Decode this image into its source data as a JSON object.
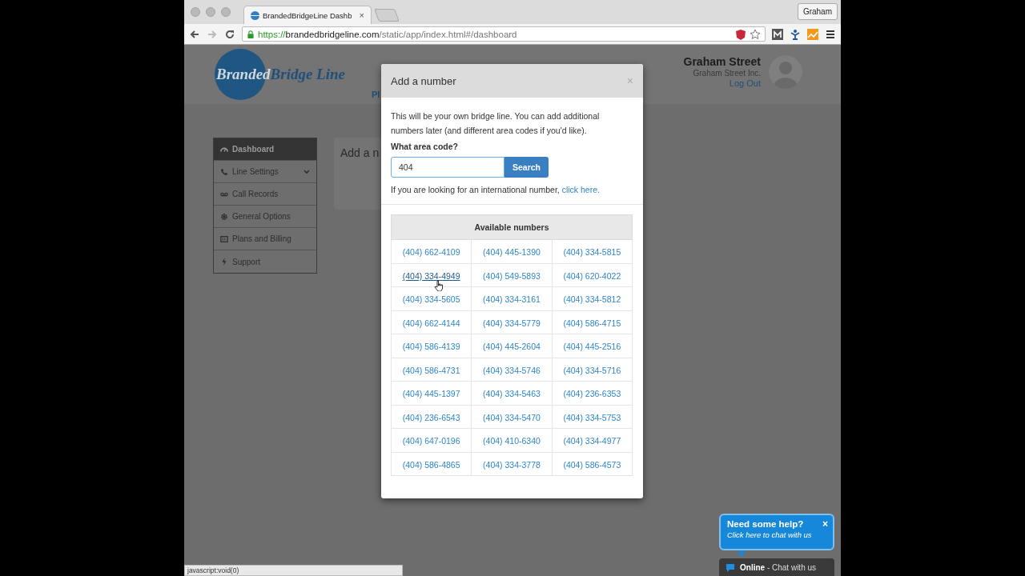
{
  "browser": {
    "tab_title": "BrandedBridgeLine Dashb",
    "tab_close": "×",
    "profile": "Graham",
    "url": {
      "scheme": "https://",
      "host": "brandedbridgeline.com",
      "path": "/static/app/index.html#/dashboard"
    },
    "status_text": "javascript:void(0)"
  },
  "header": {
    "logo": {
      "part1": "Branded",
      "part2": "Bridge Line"
    },
    "nav_partial": "Pl",
    "user": {
      "name": "Graham Street",
      "company": "Graham Street Inc.",
      "logout": "Log Out"
    }
  },
  "sidebar": {
    "items": [
      {
        "label": "Dashboard",
        "selected": true,
        "has_caret": false
      },
      {
        "label": "Line Settings",
        "selected": false,
        "has_caret": true
      },
      {
        "label": "Call Records",
        "selected": false,
        "has_caret": false
      },
      {
        "label": "General Options",
        "selected": false,
        "has_caret": false
      },
      {
        "label": "Plans and Billing",
        "selected": false,
        "has_caret": false
      },
      {
        "label": "Support",
        "selected": false,
        "has_caret": false
      }
    ]
  },
  "panel_title_partial": "Add a n",
  "modal": {
    "title": "Add a number",
    "close": "×",
    "intro": "This will be your own bridge line. You can add additional numbers later (and different area codes if you'd like).",
    "label": "What area code?",
    "input_value": "404",
    "search_button": "Search",
    "hint": "If you are looking for an international number,",
    "hint_link": "click here.",
    "table": {
      "header": "Available numbers",
      "rows": [
        [
          {
            "number": "(404) 662-4109",
            "hovered": false
          },
          {
            "number": "(404) 445-1390",
            "hovered": false
          },
          {
            "number": "(404) 334-5815",
            "hovered": false
          }
        ],
        [
          {
            "number": "(404) 334-4949",
            "hovered": true
          },
          {
            "number": "(404) 549-5893",
            "hovered": false
          },
          {
            "number": "(404) 620-4022",
            "hovered": false
          }
        ],
        [
          {
            "number": "(404) 334-5605",
            "hovered": false
          },
          {
            "number": "(404) 334-3161",
            "hovered": false
          },
          {
            "number": "(404) 334-5812",
            "hovered": false
          }
        ],
        [
          {
            "number": "(404) 662-4144",
            "hovered": false
          },
          {
            "number": "(404) 334-5779",
            "hovered": false
          },
          {
            "number": "(404) 586-4715",
            "hovered": false
          }
        ],
        [
          {
            "number": "(404) 586-4139",
            "hovered": false
          },
          {
            "number": "(404) 445-2604",
            "hovered": false
          },
          {
            "number": "(404) 445-2516",
            "hovered": false
          }
        ],
        [
          {
            "number": "(404) 586-4731",
            "hovered": false
          },
          {
            "number": "(404) 334-5746",
            "hovered": false
          },
          {
            "number": "(404) 334-5716",
            "hovered": false
          }
        ],
        [
          {
            "number": "(404) 445-1397",
            "hovered": false
          },
          {
            "number": "(404) 334-5463",
            "hovered": false
          },
          {
            "number": "(404) 236-6353",
            "hovered": false
          }
        ],
        [
          {
            "number": "(404) 236-6543",
            "hovered": false
          },
          {
            "number": "(404) 334-5470",
            "hovered": false
          },
          {
            "number": "(404) 334-5753",
            "hovered": false
          }
        ],
        [
          {
            "number": "(404) 647-0196",
            "hovered": false
          },
          {
            "number": "(404) 410-6340",
            "hovered": false
          },
          {
            "number": "(404) 334-4977",
            "hovered": false
          }
        ],
        [
          {
            "number": "(404) 586-4865",
            "hovered": false
          },
          {
            "number": "(404) 334-3778",
            "hovered": false
          },
          {
            "number": "(404) 586-4573",
            "hovered": false
          }
        ]
      ]
    }
  },
  "chat": {
    "title": "Need some help?",
    "close": "×",
    "subtitle": "Click here to chat with us",
    "status": "**Online** - Chat with us"
  }
}
